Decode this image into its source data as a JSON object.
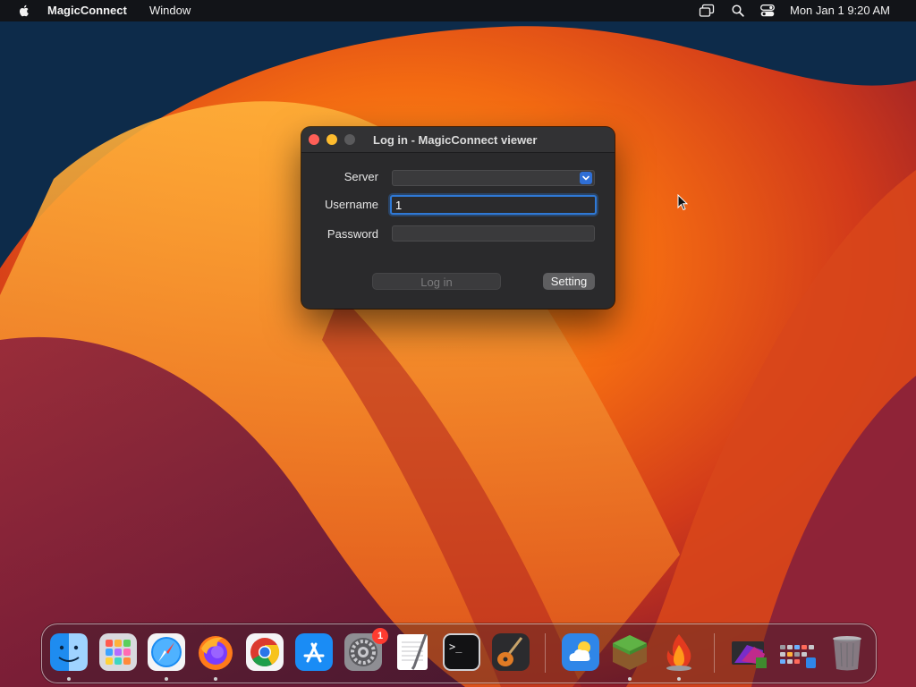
{
  "menubar": {
    "app_name": "MagicConnect",
    "menus": [
      "Window"
    ],
    "status_icons": [
      "screen-mirroring-icon",
      "spotlight-search-icon",
      "control-center-icon"
    ],
    "clock": "Mon Jan 1  9:20 AM"
  },
  "window": {
    "title": "Log in - MagicConnect viewer",
    "form": {
      "server_label": "Server",
      "server_value": "",
      "username_label": "Username",
      "username_value": "1",
      "password_label": "Password",
      "password_value": ""
    },
    "buttons": {
      "login_label": "Log in",
      "setting_label": "Setting"
    }
  },
  "dock": {
    "apps": [
      {
        "name": "Finder",
        "icon": "finder-icon",
        "running": true
      },
      {
        "name": "Launchpad",
        "icon": "launchpad-icon",
        "running": false
      },
      {
        "name": "Safari",
        "icon": "safari-icon",
        "running": true
      },
      {
        "name": "Firefox",
        "icon": "firefox-icon",
        "running": true
      },
      {
        "name": "Google Chrome",
        "icon": "chrome-icon",
        "running": false
      },
      {
        "name": "App Store",
        "icon": "app-store-icon",
        "running": false
      },
      {
        "name": "System Settings",
        "icon": "system-settings-icon",
        "running": false,
        "badge": "1"
      },
      {
        "name": "TextEdit",
        "icon": "textedit-icon",
        "running": false
      },
      {
        "name": "Terminal",
        "icon": "terminal-icon",
        "running": false
      },
      {
        "name": "GarageBand",
        "icon": "garageband-icon",
        "running": false
      },
      {
        "name": "Weather",
        "icon": "weather-icon",
        "running": false
      },
      {
        "name": "Minecraft",
        "icon": "minecraft-icon",
        "running": true
      },
      {
        "name": "Flame app",
        "icon": "flame-icon",
        "running": true
      },
      {
        "name": "Downloads stack",
        "icon": "downloads-stack-icon",
        "running": false
      },
      {
        "name": "Apps folder stack",
        "icon": "apps-folder-icon",
        "running": false
      },
      {
        "name": "Trash",
        "icon": "trash-icon",
        "running": false
      }
    ]
  },
  "colors": {
    "accent": "#2f79d6",
    "close": "#ff5f57",
    "minimize": "#febc2e",
    "badge": "#ff3b30"
  }
}
